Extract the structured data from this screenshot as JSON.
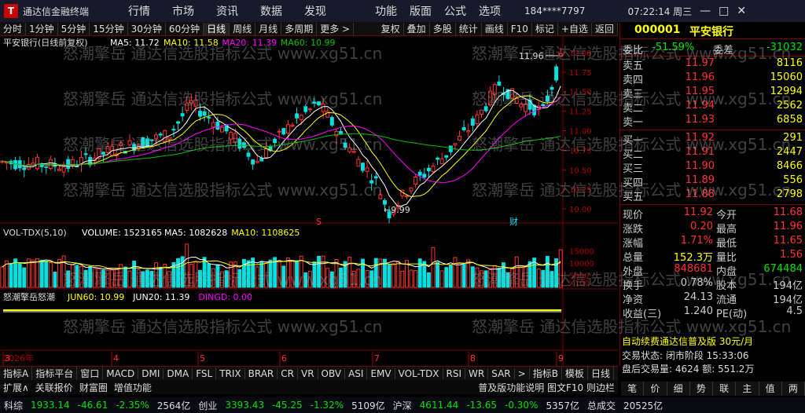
{
  "app": {
    "title": "通达信金融终端",
    "logo": "T",
    "menus": [
      "行情",
      "市场",
      "资讯",
      "数据",
      "发现"
    ],
    "menus2": [
      "功能",
      "版面",
      "公式",
      "选项"
    ],
    "account": "184****7797",
    "time": "07:22:14 周三",
    "win": [
      "—",
      "□",
      "✕"
    ]
  },
  "toolbar": {
    "left": [
      "分时",
      "1分钟",
      "5分钟",
      "15分钟",
      "30分钟",
      "60分钟",
      "日线",
      "周线",
      "月线",
      "多周期",
      "更多 >"
    ],
    "right": [
      "复权",
      "叠加",
      "多股",
      "统计",
      "画线",
      "F10",
      "标记",
      "+自选",
      "返回"
    ],
    "selected": "日线"
  },
  "chart": {
    "title": "平安银行(日线前复权)",
    "ma_labels": [
      {
        "t": "MA5: 11.72",
        "c": "#ffffff"
      },
      {
        "t": "MA10: 11.58",
        "c": "#ffff00"
      },
      {
        "t": "MA20: 11.39",
        "c": "#ff00ff"
      },
      {
        "t": "MA60: 10.99",
        "c": "#00c000"
      }
    ],
    "high_label": "11.96",
    "low_label": "9.99",
    "badge_s": "S",
    "badge_cai": "财",
    "yticks": [
      "12.00",
      "11.75",
      "11.50",
      "11.25",
      "11.00",
      "10.75",
      "10.50",
      "10.25",
      "10.00"
    ]
  },
  "volume": {
    "title": "VOL-TDX(5,10)",
    "labels": [
      {
        "t": "VOLUME: 1523165",
        "c": "#ffffff"
      },
      {
        "t": "MA5: 1082628",
        "c": "#ffffff"
      },
      {
        "t": "MA10: 1108625",
        "c": "#ffff00"
      }
    ],
    "yticks": [
      "15000",
      "10000",
      "5000"
    ],
    "unit": "X100"
  },
  "indicator": {
    "title": "怒潮擎岳怒潮",
    "labels": [
      {
        "t": "JUN60: 10.99",
        "c": "#ffff00"
      },
      {
        "t": "JUN20: 11.39",
        "c": "#ffffff"
      },
      {
        "t": "DINGD: 0.00",
        "c": "#ff00ff"
      }
    ]
  },
  "xaxis": {
    "year": "2026年",
    "months": [
      "3",
      "4",
      "5",
      "6",
      "7",
      "8",
      "9"
    ]
  },
  "right": {
    "code": "000001",
    "name": "平安银行",
    "weibi_label": "委比",
    "weibi": "-51.59%",
    "weicha_label": "委差",
    "weicha": "-31032",
    "asks": [
      {
        "l": "卖五",
        "p": "11.97",
        "v": "8116"
      },
      {
        "l": "卖四",
        "p": "11.96",
        "v": "15060"
      },
      {
        "l": "卖三",
        "p": "11.95",
        "v": "12994"
      },
      {
        "l": "卖二",
        "p": "11.94",
        "v": "2562"
      },
      {
        "l": "卖一",
        "p": "11.93",
        "v": "6858"
      }
    ],
    "bids": [
      {
        "l": "买一",
        "p": "11.92",
        "v": "291"
      },
      {
        "l": "买二",
        "p": "11.91",
        "v": "2447"
      },
      {
        "l": "买三",
        "p": "11.90",
        "v": "8466"
      },
      {
        "l": "买四",
        "p": "11.89",
        "v": "556"
      },
      {
        "l": "买五",
        "p": "11.88",
        "v": "2798"
      }
    ],
    "stats": [
      {
        "a": "现价",
        "b": "11.92",
        "bc": "#ff3232",
        "c": "今开",
        "d": "11.68",
        "dc": "#ff3232"
      },
      {
        "a": "涨跌",
        "b": "0.20",
        "bc": "#ff3232",
        "c": "最高",
        "d": "11.96",
        "dc": "#ff3232"
      },
      {
        "a": "涨幅",
        "b": "1.71%",
        "bc": "#ff3232",
        "c": "最低",
        "d": "11.65",
        "dc": "#ff3232"
      },
      {
        "a": "总量",
        "b": "152.3万",
        "bc": "#ffff00",
        "c": "量比",
        "d": "1.56",
        "dc": "#ff3232"
      },
      {
        "a": "外盘",
        "b": "848681",
        "bc": "#ff3232",
        "c": "内盘",
        "d": "674484",
        "dc": "#00e000"
      },
      {
        "a": "换手",
        "b": "0.78%",
        "bc": "#ccc",
        "c": "股本",
        "d": "194亿",
        "dc": "#ccc"
      },
      {
        "a": "净资",
        "b": "24.13",
        "bc": "#ccc",
        "c": "流通",
        "d": "194亿",
        "dc": "#ccc"
      },
      {
        "a": "收益(三)",
        "b": "1.240",
        "bc": "#ccc",
        "c": "PE(动)",
        "d": "4.5",
        "dc": "#ccc"
      }
    ],
    "promo": "自动续费通达信普及版 30元/月",
    "trade_state": "交易状态: 闭市阶段 15:33:06",
    "after_hours": "盘后交易量: 4624  额: 551.2万",
    "tabs": [
      "笔",
      "价",
      "细",
      "势",
      "联",
      "主",
      "值",
      "两"
    ]
  },
  "bottom": {
    "tabs": [
      "指标A",
      "指标平台",
      "窗口",
      "MACD",
      "DMI",
      "DMA",
      "FSL",
      "TRIX",
      "BRAR",
      "CR",
      "VR",
      "OBV",
      "ASI",
      "EMV",
      "VOL-TDX",
      "RSI",
      "WR",
      "SAR",
      ">",
      "指标B",
      "模板",
      "日线"
    ],
    "row2": [
      "扩展∧",
      "关联报价",
      "财富圈",
      "增值功能"
    ],
    "row2r": "普及版功能说明  图文F10 则边栏"
  },
  "status": [
    {
      "t": "科综",
      "c": "#ddd"
    },
    {
      "t": "1933.14",
      "c": "#00e000"
    },
    {
      "t": "-46.61",
      "c": "#00e000"
    },
    {
      "t": "-2.35%",
      "c": "#00e000"
    },
    {
      "t": "2564亿",
      "c": "#ddd"
    },
    {
      "t": "创业",
      "c": "#ddd"
    },
    {
      "t": "3393.43",
      "c": "#00e000"
    },
    {
      "t": "-45.25",
      "c": "#00e000"
    },
    {
      "t": "-1.32%",
      "c": "#00e000"
    },
    {
      "t": "5109亿",
      "c": "#ddd"
    },
    {
      "t": "沪深",
      "c": "#ddd"
    },
    {
      "t": "4611.44",
      "c": "#00e000"
    },
    {
      "t": "-13.65",
      "c": "#00e000"
    },
    {
      "t": "-0.30%",
      "c": "#00e000"
    },
    {
      "t": "5357亿",
      "c": "#ddd"
    },
    {
      "t": "总成交",
      "c": "#ddd"
    },
    {
      "t": "20525亿",
      "c": "#ddd"
    }
  ],
  "watermark": "怒潮擎岳 通达信选股指标公式 www.xg51.cn"
}
